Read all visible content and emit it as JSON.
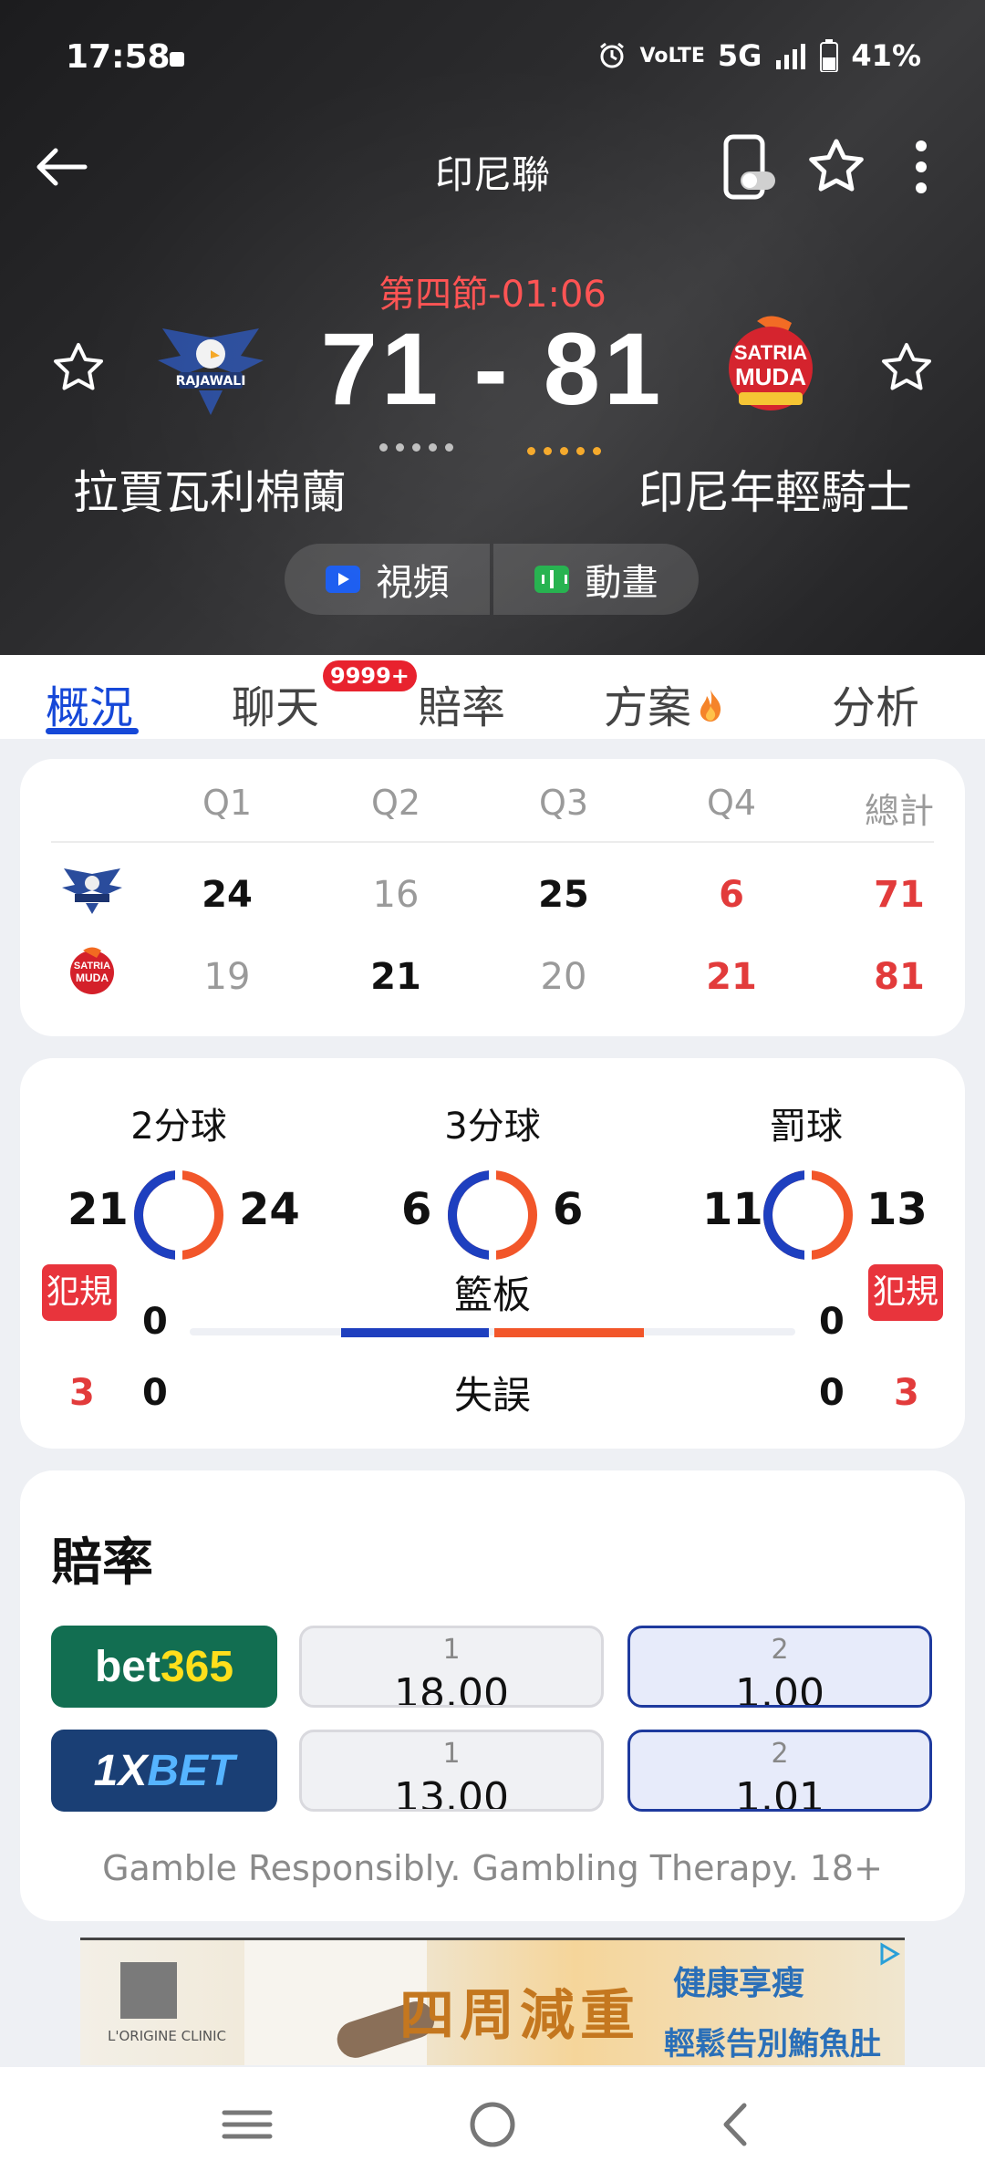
{
  "status_bar": {
    "time": "17:58",
    "network_label": "5G",
    "lte_label": "VoLTE",
    "battery": "41%"
  },
  "header": {
    "title": "印尼聯",
    "period": "第四節-01:06",
    "score": "71 - 81",
    "home_team": "拉賈瓦利棉蘭",
    "away_team": "印尼年輕騎士",
    "video_label": "視頻",
    "animation_label": "動畫"
  },
  "tabs": {
    "overview": "概況",
    "chat": "聊天",
    "chat_badge": "9999+",
    "odds": "賠率",
    "plans": "方案",
    "analysis": "分析",
    "active": "overview"
  },
  "scoreboard": {
    "headers": [
      "Q1",
      "Q2",
      "Q3",
      "Q4",
      "總計"
    ],
    "home": [
      "24",
      "16",
      "25",
      "6",
      "71"
    ],
    "away": [
      "19",
      "21",
      "20",
      "21",
      "81"
    ]
  },
  "stats": {
    "two_pt": {
      "label": "2分球",
      "home": "21",
      "away": "24"
    },
    "three_pt": {
      "label": "3分球",
      "home": "6",
      "away": "6"
    },
    "free_throw": {
      "label": "罰球",
      "home": "11",
      "away": "13"
    },
    "foul_label": "犯規",
    "rebound_label": "籃板",
    "turnover_label": "失誤",
    "home_rebounds": "0",
    "away_rebounds": "0",
    "home_fouls": "3",
    "away_fouls": "3",
    "home_turnovers": "0",
    "away_turnovers": "0"
  },
  "odds": {
    "title": "賠率",
    "rows": [
      {
        "bookmaker": "bet365",
        "home_label": "1",
        "home_value": "18.00",
        "away_label": "2",
        "away_value": "1.00"
      },
      {
        "bookmaker": "1XBET",
        "home_label": "1",
        "home_value": "13.00",
        "away_label": "2",
        "away_value": "1.01"
      }
    ],
    "disclaimer": "Gamble Responsibly. Gambling Therapy. 18+"
  },
  "ad": {
    "main": "四周減重",
    "brand": "健康享瘦",
    "sub": "輕鬆告別鮪魚肚",
    "clinic": "L'ORIGINE CLINIC"
  },
  "colors": {
    "accent": "#1648d8",
    "home_ring": "#1e3fbf",
    "away_ring": "#f2562a",
    "red": "#e23b3b"
  }
}
